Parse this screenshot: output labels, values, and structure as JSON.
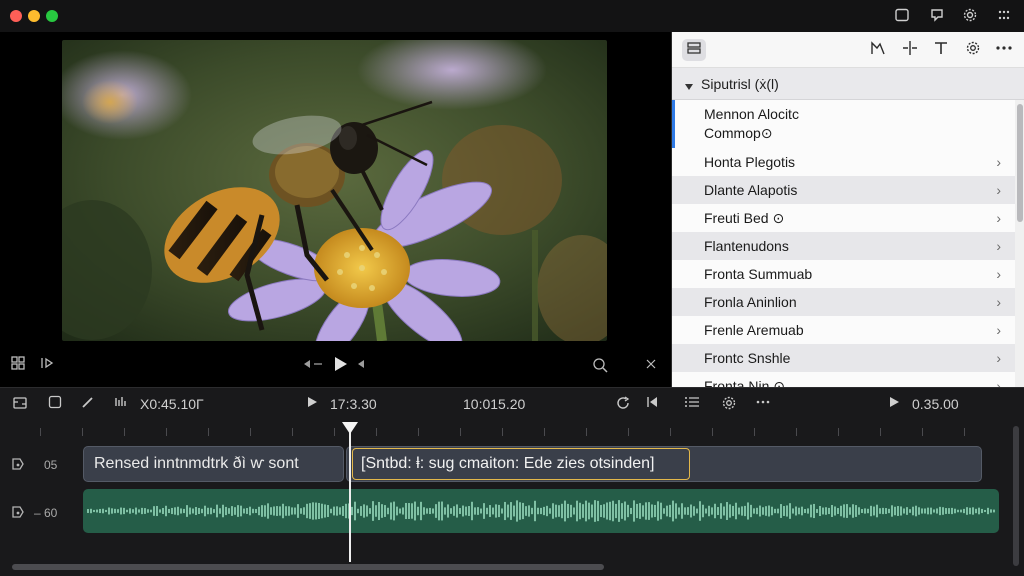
{
  "window": {
    "titlebar_icons": [
      "sidebar-icon",
      "share-icon",
      "gear-icon",
      "grid-icon"
    ]
  },
  "viewer": {
    "image": "bee-on-flower",
    "controls": {
      "left": [
        "layout-icon",
        "skip-end-icon"
      ],
      "center": [
        "step-back-icon",
        "play-icon",
        "step-forward-icon"
      ],
      "right": [
        "zoom-icon",
        "collapse-icon"
      ]
    }
  },
  "inspector": {
    "toolbar_icons": [
      "titles-icon",
      "adjust-icon",
      "split-icon",
      "text-icon",
      "settings-icon",
      "more-icon"
    ],
    "section_title": "Siputrisl (ẋ(l)",
    "items": [
      {
        "label_line1": "Mennon Alocitc",
        "label_line2": "Commop⊙",
        "selected": true
      },
      {
        "label": "Honta Plegotis"
      },
      {
        "label": "Dlante Alapotis"
      },
      {
        "label": "Freuti Bed ⊙"
      },
      {
        "label": "Flantenudons"
      },
      {
        "label": "Fronta Summuab"
      },
      {
        "label": "Fronla Aninlion"
      },
      {
        "label": "Frenle Aremuab"
      },
      {
        "label": "Frontc Snshle"
      },
      {
        "label": "Fronta Nin ⊙"
      }
    ]
  },
  "timeline": {
    "timecode_left": "X0:45.10Γ",
    "timecode_play": "17:3.30",
    "timecode_center": "10:015.20",
    "timecode_right": "0.35.00",
    "track1_label": "05",
    "track2_label": "– 60",
    "clip_title": "Rensed inntnmdtrk ðì ⱳ sont",
    "clip_selected": "[Sntbd: ⱡ: sug cmaiton: Ede zies otsinden]"
  },
  "colors": {
    "accent_selection": "#2f7ae5",
    "clip_selected_border": "#e3b84b",
    "audio_clip": "#255d48",
    "waveform": "#7fc0a4"
  }
}
